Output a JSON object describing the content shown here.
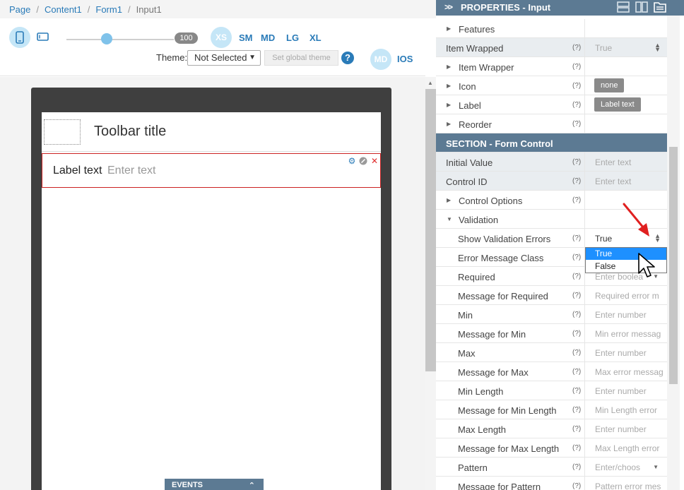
{
  "breadcrumb": [
    "Page",
    "Content1",
    "Form1",
    "Input1"
  ],
  "toolbar": {
    "zoom_value": "100",
    "breakpoints": [
      "XS",
      "SM",
      "MD",
      "LG",
      "XL"
    ],
    "theme_label": "Theme:",
    "theme_value": "Not Selected",
    "set_global_theme": "Set global theme",
    "help": "?",
    "modes": [
      "MD",
      "IOS"
    ]
  },
  "preview": {
    "toolbar_title": "Toolbar title",
    "input_label": "Label text",
    "input_placeholder": "Enter text",
    "events": "EVENTS"
  },
  "properties": {
    "header": "PROPERTIES - Input",
    "rows": [
      {
        "name": "Features",
        "type": "group"
      },
      {
        "name": "Item Wrapped",
        "type": "select",
        "value": "True",
        "q": "(?)"
      },
      {
        "name": "Item Wrapper",
        "type": "group",
        "q": "(?)"
      },
      {
        "name": "Icon",
        "type": "chip",
        "value": "none",
        "q": "(?)"
      },
      {
        "name": "Label",
        "type": "chip",
        "value": "Label text",
        "q": "(?)"
      },
      {
        "name": "Reorder",
        "type": "group",
        "q": "(?)"
      },
      {
        "name": "SECTION - Form Control",
        "type": "section"
      },
      {
        "name": "Initial Value",
        "type": "text",
        "value": "Enter text",
        "q": "(?)"
      },
      {
        "name": "Control ID",
        "type": "text",
        "value": "Enter text",
        "q": "(?)"
      },
      {
        "name": "Control Options",
        "type": "group",
        "q": "(?)"
      },
      {
        "name": "Validation",
        "type": "open-group"
      },
      {
        "name": "Show Validation Errors",
        "type": "select-active",
        "value": "True",
        "q": "(?)"
      },
      {
        "name": "Error Message Class",
        "type": "sub",
        "q": "(?)"
      },
      {
        "name": "Required",
        "type": "sub-dd",
        "value": "Enter boolea",
        "q": "(?)"
      },
      {
        "name": "Message for Required",
        "type": "sub",
        "value": "Required error m",
        "q": "(?)"
      },
      {
        "name": "Min",
        "type": "sub",
        "value": "Enter number",
        "q": "(?)"
      },
      {
        "name": "Message for Min",
        "type": "sub",
        "value": "Min error messag",
        "q": "(?)"
      },
      {
        "name": "Max",
        "type": "sub",
        "value": "Enter number",
        "q": "(?)"
      },
      {
        "name": "Message for Max",
        "type": "sub",
        "value": "Max error messag",
        "q": "(?)"
      },
      {
        "name": "Min Length",
        "type": "sub",
        "value": "Enter number",
        "q": "(?)"
      },
      {
        "name": "Message for Min Length",
        "type": "sub",
        "value": "Min Length error",
        "q": "(?)"
      },
      {
        "name": "Max Length",
        "type": "sub",
        "value": "Enter number",
        "q": "(?)"
      },
      {
        "name": "Message for Max Length",
        "type": "sub",
        "value": "Max Length error",
        "q": "(?)"
      },
      {
        "name": "Pattern",
        "type": "sub-dd",
        "value": "Enter/choos",
        "q": "(?)"
      },
      {
        "name": "Message for Pattern",
        "type": "sub",
        "value": "Pattern error mes",
        "q": "(?)"
      }
    ],
    "dropdown_options": [
      "True",
      "False"
    ]
  },
  "colors": {
    "accent": "#2a7bb8",
    "section_bg": "#5c7a93",
    "selection": "#1e90ff",
    "error_border": "#cc2222"
  }
}
